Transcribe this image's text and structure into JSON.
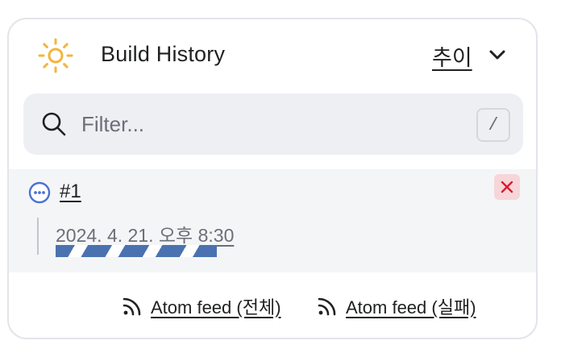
{
  "header": {
    "title": "Build History",
    "trend_label": "추이",
    "icon": "sun-icon",
    "icon_color": "#f2b53d"
  },
  "search": {
    "placeholder": "Filter...",
    "value": "",
    "shortcut_key": "/"
  },
  "builds": [
    {
      "number": "#1",
      "status": "in-progress",
      "timestamp": "2024. 4. 21. 오후 8:30",
      "cancel_icon": "close-icon"
    }
  ],
  "footer": {
    "feed_all": "Atom feed (전체)",
    "feed_failed": "Atom feed (실패)"
  },
  "colors": {
    "accent_blue": "#4a72b0",
    "cancel_bg": "#f6d6d9",
    "cancel_x": "#d4202e",
    "status_blue": "#4a72d0"
  }
}
